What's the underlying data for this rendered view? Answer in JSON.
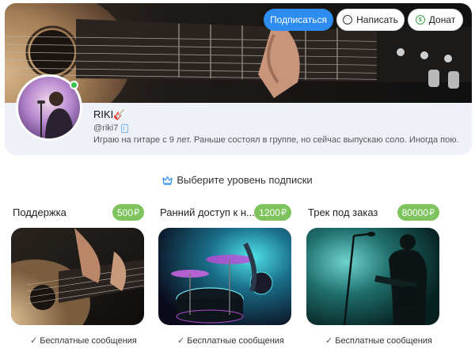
{
  "profile": {
    "name": "RIKI",
    "name_emoji": "🎸",
    "handle": "@riki7",
    "bio": "Играю на гитаре с 9 лет. Раньше состоял в группе, но сейчас выпускаю соло. Иногда пою.",
    "online": true
  },
  "actions": {
    "subscribe_label": "Подписаться",
    "message_label": "Написать",
    "donate_label": "Донат"
  },
  "tiers_section": {
    "title": "Выберите уровень подписки"
  },
  "tiers": [
    {
      "name": "Поддержка",
      "price": "500",
      "currency": "₽",
      "feature": "Бесплатные сообщения"
    },
    {
      "name": "Ранний доступ к н...",
      "price": "1200",
      "currency": "₽",
      "feature": "Бесплатные сообщения"
    },
    {
      "name": "Трек под заказ",
      "price": "80000",
      "currency": "₽",
      "feature": "Бесплатные сообщения"
    }
  ],
  "colors": {
    "accent": "#2d8cf0",
    "price_badge": "#7ec35d",
    "online": "#37c24a",
    "card_bg": "#eef1f7"
  },
  "icons": [
    "message-icon",
    "donate-icon",
    "crown-icon",
    "telegram-icon",
    "check-icon"
  ]
}
